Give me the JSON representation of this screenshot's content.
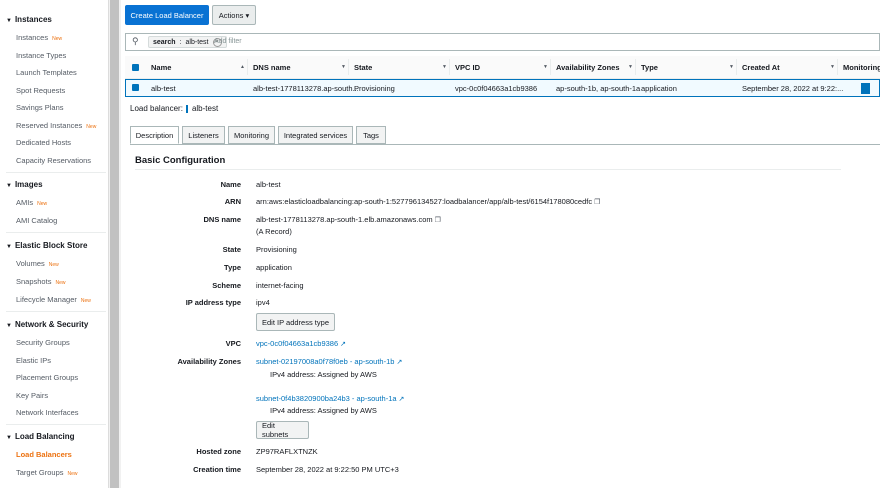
{
  "sidebar": {
    "groups": [
      {
        "title": "Instances",
        "items": [
          {
            "label": "Instances",
            "new": "New"
          },
          {
            "label": "Instance Types"
          },
          {
            "label": "Launch Templates"
          },
          {
            "label": "Spot Requests"
          },
          {
            "label": "Savings Plans"
          },
          {
            "label": "Reserved Instances",
            "new": "New"
          },
          {
            "label": "Dedicated Hosts"
          },
          {
            "label": "Capacity Reservations"
          }
        ]
      },
      {
        "title": "Images",
        "items": [
          {
            "label": "AMIs",
            "new": "New"
          },
          {
            "label": "AMI Catalog"
          }
        ]
      },
      {
        "title": "Elastic Block Store",
        "items": [
          {
            "label": "Volumes",
            "new": "New"
          },
          {
            "label": "Snapshots",
            "new": "New"
          },
          {
            "label": "Lifecycle Manager",
            "new": "New"
          }
        ]
      },
      {
        "title": "Network & Security",
        "items": [
          {
            "label": "Security Groups"
          },
          {
            "label": "Elastic IPs"
          },
          {
            "label": "Placement Groups"
          },
          {
            "label": "Key Pairs"
          },
          {
            "label": "Network Interfaces"
          }
        ]
      },
      {
        "title": "Load Balancing",
        "items": [
          {
            "label": "Load Balancers"
          },
          {
            "label": "Target Groups",
            "new": "New"
          }
        ]
      }
    ]
  },
  "toolbar": {
    "create_label": "Create Load Balancer",
    "actions_label": "Actions",
    "actions_caret": "▾"
  },
  "search": {
    "chip_key": "search",
    "chip_value": "alb-test",
    "placeholder": "Add filter"
  },
  "table": {
    "headers": [
      "Name",
      "DNS name",
      "State",
      "VPC ID",
      "Availability Zones",
      "Type",
      "Created At",
      "Monitoring"
    ],
    "row": {
      "name": "alb-test",
      "dns": "alb-test-1778113278.ap-south...",
      "state": "Provisioning",
      "vpc": "vpc-0c0f04663a1cb9386",
      "az": "ap-south-1b, ap-south-1a",
      "type": "application",
      "created": "September 28, 2022 at 9:22:..."
    }
  },
  "detail": {
    "lb_label": "Load balancer:",
    "lb_name": "alb-test",
    "tabs": [
      "Description",
      "Listeners",
      "Monitoring",
      "Integrated services",
      "Tags"
    ],
    "section_title": "Basic Configuration",
    "fields": {
      "name_label": "Name",
      "name": "alb-test",
      "arn_label": "ARN",
      "arn": "arn:aws:elasticloadbalancing:ap-south-1:527796134527:loadbalancer/app/alb-test/6154f178080cedfc",
      "dns_label": "DNS name",
      "dns": "alb-test-1778113278.ap-south-1.elb.amazonaws.com",
      "dns_record": "(A Record)",
      "state_label": "State",
      "state": "Provisioning",
      "type_label": "Type",
      "type": "application",
      "scheme_label": "Scheme",
      "scheme": "internet-facing",
      "ip_label": "IP address type",
      "ip": "ipv4",
      "edit_ip_label": "Edit IP address type",
      "vpc_label": "VPC",
      "vpc": "vpc-0c0f04663a1cb9386",
      "az_label": "Availability Zones",
      "subnet1": "subnet-02197008a0f78f0eb - ap-south-1b",
      "subnet1_ipv4": "IPv4 address: Assigned by AWS",
      "subnet2": "subnet-0f4b3820900ba24b3 - ap-south-1a",
      "subnet2_ipv4": "IPv4 address: Assigned by AWS",
      "edit_subnets_label": "Edit subnets",
      "zone_label": "Hosted zone",
      "zone": "ZP97RAFLXTNZK",
      "created_label": "Creation time",
      "created": "September 28, 2022 at 9:22:50 PM UTC+3"
    }
  }
}
